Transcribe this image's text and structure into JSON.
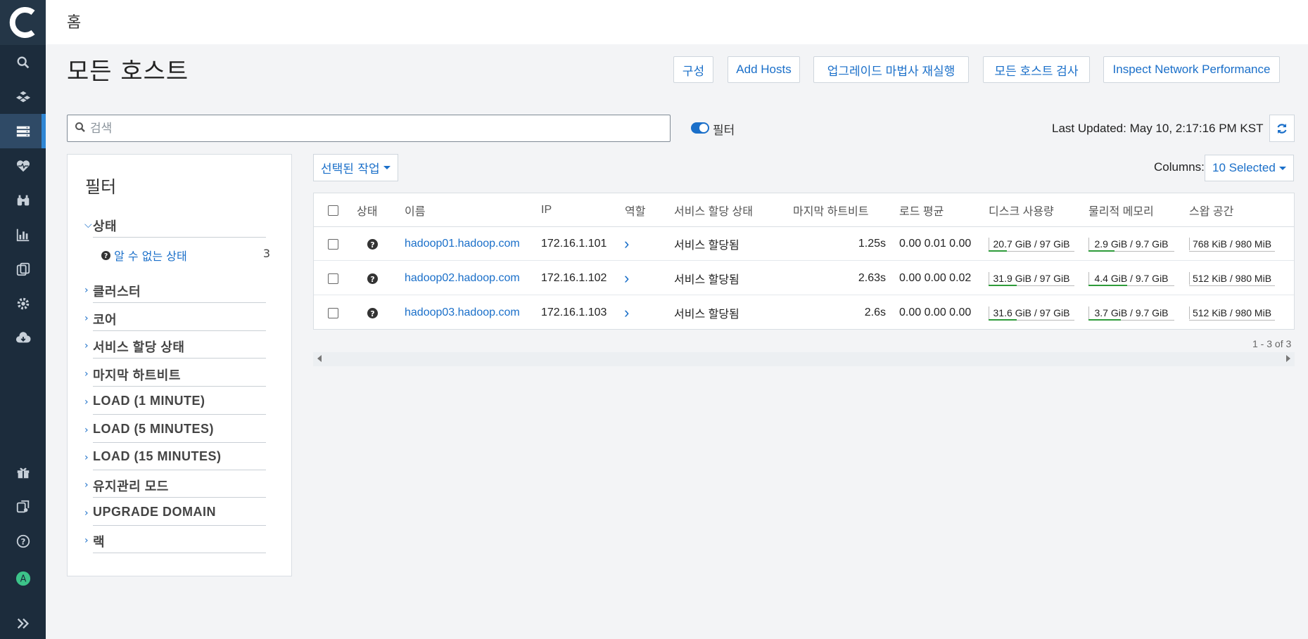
{
  "topbar": {
    "title": "홈"
  },
  "page": {
    "title": "모든 호스트"
  },
  "toolbar": {
    "config": "구성",
    "add_hosts": "Add Hosts",
    "upgrade_wizard": "업그레이드 마법사 재실행",
    "inspect_all": "모든 호스트 검사",
    "inspect_network": "Inspect Network Performance"
  },
  "search": {
    "placeholder": "검색",
    "value": ""
  },
  "filter_toggle": {
    "label": "필터",
    "on": true
  },
  "last_updated": "Last Updated: May 10, 2:17:16 PM KST",
  "filters": {
    "title": "필터",
    "groups": [
      "상태",
      "클러스터",
      "코어",
      "서비스 할당 상태",
      "마지막 하트비트",
      "LOAD (1 MINUTE)",
      "LOAD (5 MINUTES)",
      "LOAD (15 MINUTES)",
      "유지관리 모드",
      "UPGRADE DOMAIN",
      "랙"
    ],
    "status_sub": {
      "label": "알 수 없는 상태",
      "count": "3"
    }
  },
  "actions": {
    "selected_actions": "선택된 작업",
    "columns_label": "Columns:",
    "columns_value": "10 Selected"
  },
  "table": {
    "headers": [
      "상태",
      "이름",
      "IP",
      "역할",
      "서비스 할당 상태",
      "마지막 하트비트",
      "로드 평균",
      "디스크 사용량",
      "물리적 메모리",
      "스왑 공간"
    ],
    "rows": [
      {
        "name": "hadoop01.hadoop.com",
        "ip": "172.16.1.101",
        "role": "›",
        "assign": "서비스 할당됨",
        "heartbeat": "1.25s",
        "load": "0.00 0.01 0.00",
        "disk": "20.7 GiB / 97 GiB",
        "disk_pct": 21,
        "mem": "2.9 GiB / 9.7 GiB",
        "mem_pct": 30,
        "swap": "768 KiB / 980 MiB",
        "swap_pct": 0
      },
      {
        "name": "hadoop02.hadoop.com",
        "ip": "172.16.1.102",
        "role": "›",
        "assign": "서비스 할당됨",
        "heartbeat": "2.63s",
        "load": "0.00 0.00 0.02",
        "disk": "31.9 GiB / 97 GiB",
        "disk_pct": 33,
        "mem": "4.4 GiB / 9.7 GiB",
        "mem_pct": 45,
        "swap": "512 KiB / 980 MiB",
        "swap_pct": 0
      },
      {
        "name": "hadoop03.hadoop.com",
        "ip": "172.16.1.103",
        "role": "›",
        "assign": "서비스 할당됨",
        "heartbeat": "2.6s",
        "load": "0.00 0.00 0.00",
        "disk": "31.6 GiB / 97 GiB",
        "disk_pct": 33,
        "mem": "3.7 GiB / 9.7 GiB",
        "mem_pct": 38,
        "swap": "512 KiB / 980 MiB",
        "swap_pct": 0
      }
    ],
    "pager": "1 - 3 of 3"
  },
  "colors": {
    "accent": "#1a6fc9",
    "sidebar": "#1c2c3c",
    "bar_fill": "#2e9b3a"
  },
  "sidebar_icons": [
    "search-icon",
    "clusters-icon",
    "hosts-icon",
    "diagnostics-icon",
    "audits-icon",
    "charts-icon",
    "replication-icon",
    "administration-icon",
    "parcel-download-icon",
    "gift-icon",
    "backup-icon",
    "help-icon",
    "user-avatar",
    "expand-icon"
  ]
}
